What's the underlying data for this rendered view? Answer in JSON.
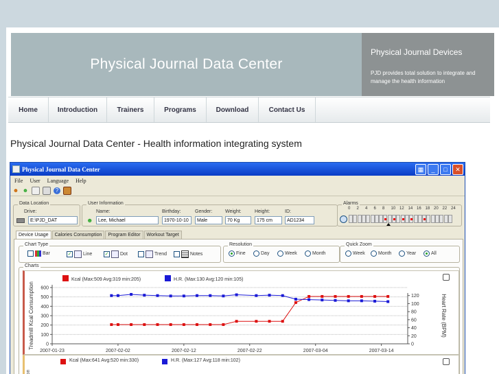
{
  "site": {
    "banner_title": "Physical Journal Data Center",
    "side_title": "Physical Journal Devices",
    "side_text": "PJD provides total solution to integrate and manage the health information",
    "nav": [
      "Home",
      "Introduction",
      "Trainers",
      "Programs",
      "Download",
      "Contact Us"
    ],
    "page_heading": "Physical Journal Data Center - Health information integrating system"
  },
  "app": {
    "title": "Physical Journal Data Center",
    "menu": [
      "File",
      "User",
      "Language",
      "Help"
    ],
    "data_location": {
      "legend": "Data Location",
      "drive_label": "Drive:",
      "drive_value": "E:\\PJD_DAT"
    },
    "user_info": {
      "legend": "User Information",
      "name_label": "Name:",
      "name_value": "Lee, Michael",
      "birthday_label": "Birthday:",
      "birthday_value": "1970-10-10",
      "gender_label": "Gender:",
      "gender_value": "Male",
      "weight_label": "Weight:",
      "weight_value": "70 Kg",
      "height_label": "Height:",
      "height_value": "175 cm",
      "id_label": "ID:",
      "id_value": "AD1234"
    },
    "alarms": {
      "legend": "Alarms",
      "hours": [
        "0",
        "2",
        "4",
        "6",
        "8",
        "10",
        "12",
        "14",
        "16",
        "18",
        "20",
        "22",
        "24"
      ],
      "active_slots": [
        8,
        10,
        12,
        14,
        17
      ]
    },
    "tabs": [
      "Device Usage",
      "Calories Consumption",
      "Program Editor",
      "Workout Target"
    ],
    "chart_type": {
      "legend": "Chart Type",
      "options": [
        {
          "label": "Bar",
          "checked": false
        },
        {
          "label": "Line",
          "checked": true
        },
        {
          "label": "Dot",
          "checked": true
        },
        {
          "label": "Trend",
          "checked": false
        },
        {
          "label": "Notes",
          "checked": false
        }
      ]
    },
    "resolution": {
      "legend": "Resolution",
      "options": [
        "Fine",
        "Day",
        "Week",
        "Month"
      ],
      "selected": "Fine"
    },
    "quick_zoom": {
      "legend": "Quick Zoom",
      "options": [
        "Week",
        "Month",
        "Year",
        "All"
      ],
      "selected": "All"
    },
    "charts_legend": "Charts"
  },
  "chart_data": [
    {
      "type": "line",
      "colors": {
        "kcal": "#dd1111",
        "hr": "#1a1ad6"
      },
      "left_label": "Treadmill Kcal Consumption",
      "right_label": "Heart Rate (BPM)",
      "kcal_legend": "Kcal (Max:509 Avg:319 min:205)",
      "hr_legend": "H.R. (Max:130 Avg:120 min:105)",
      "ylim_left": [
        0,
        600
      ],
      "yticks_left": [
        "600",
        "500",
        "400",
        "300",
        "200",
        "100",
        "0"
      ],
      "ylim_right": [
        0,
        140
      ],
      "yticks_right": [
        "120",
        "100",
        "80",
        "60",
        "40",
        "20",
        "0"
      ],
      "xlim": [
        "2007-01-23",
        "2007-03-18"
      ],
      "xticks": [
        "2007-01-23",
        "2007-02-02",
        "2007-02-12",
        "2007-02-22",
        "2007-03-04",
        "2007-03-14"
      ],
      "kcal_series": [
        {
          "x": "2007-02-01",
          "y": 205
        },
        {
          "x": "2007-02-02",
          "y": 205
        },
        {
          "x": "2007-02-04",
          "y": 205
        },
        {
          "x": "2007-02-06",
          "y": 205
        },
        {
          "x": "2007-02-08",
          "y": 205
        },
        {
          "x": "2007-02-10",
          "y": 205
        },
        {
          "x": "2007-02-12",
          "y": 205
        },
        {
          "x": "2007-02-14",
          "y": 205
        },
        {
          "x": "2007-02-16",
          "y": 205
        },
        {
          "x": "2007-02-18",
          "y": 205
        },
        {
          "x": "2007-02-20",
          "y": 240
        },
        {
          "x": "2007-02-23",
          "y": 240
        },
        {
          "x": "2007-02-25",
          "y": 240
        },
        {
          "x": "2007-02-27",
          "y": 240
        },
        {
          "x": "2007-03-01",
          "y": 440
        },
        {
          "x": "2007-03-03",
          "y": 505
        },
        {
          "x": "2007-03-05",
          "y": 505
        },
        {
          "x": "2007-03-07",
          "y": 505
        },
        {
          "x": "2007-03-09",
          "y": 505
        },
        {
          "x": "2007-03-11",
          "y": 505
        },
        {
          "x": "2007-03-13",
          "y": 505
        },
        {
          "x": "2007-03-15",
          "y": 505
        }
      ],
      "hr_series": [
        {
          "x": "2007-02-01",
          "y": 120
        },
        {
          "x": "2007-02-02",
          "y": 120
        },
        {
          "x": "2007-02-04",
          "y": 123
        },
        {
          "x": "2007-02-06",
          "y": 121
        },
        {
          "x": "2007-02-08",
          "y": 120
        },
        {
          "x": "2007-02-10",
          "y": 119
        },
        {
          "x": "2007-02-12",
          "y": 119
        },
        {
          "x": "2007-02-14",
          "y": 120
        },
        {
          "x": "2007-02-16",
          "y": 120
        },
        {
          "x": "2007-02-18",
          "y": 119
        },
        {
          "x": "2007-02-20",
          "y": 122
        },
        {
          "x": "2007-02-23",
          "y": 120
        },
        {
          "x": "2007-02-25",
          "y": 121
        },
        {
          "x": "2007-02-27",
          "y": 120
        },
        {
          "x": "2007-03-01",
          "y": 111
        },
        {
          "x": "2007-03-03",
          "y": 110
        },
        {
          "x": "2007-03-05",
          "y": 109
        },
        {
          "x": "2007-03-07",
          "y": 108
        },
        {
          "x": "2007-03-09",
          "y": 107
        },
        {
          "x": "2007-03-11",
          "y": 107
        },
        {
          "x": "2007-03-13",
          "y": 106
        },
        {
          "x": "2007-03-15",
          "y": 105
        }
      ]
    },
    {
      "type": "line",
      "left_label": "ion",
      "kcal_legend": "Kcal (Max:641 Avg:520 min:330)",
      "hr_legend": "H.R. (Max:127 Avg:118 min:102)"
    }
  ]
}
